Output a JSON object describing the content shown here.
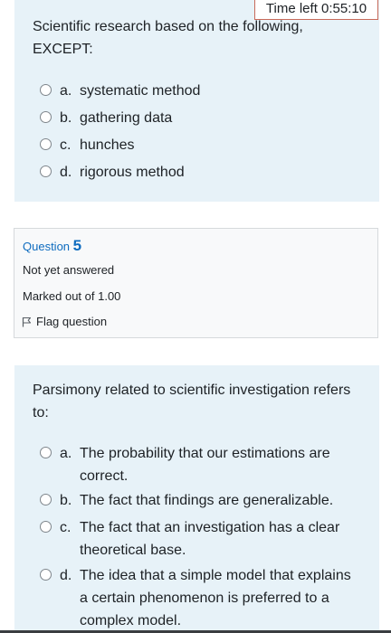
{
  "timer": {
    "label": "Time left 0:55:10"
  },
  "q4": {
    "text": "Scientific research based on the following, EXCEPT:",
    "options": [
      {
        "letter": "a.",
        "text": "systematic method"
      },
      {
        "letter": "b.",
        "text": "gathering data"
      },
      {
        "letter": "c.",
        "text": "hunches"
      },
      {
        "letter": "d.",
        "text": "rigorous method"
      }
    ]
  },
  "q5": {
    "info": {
      "label": "Question",
      "number": "5",
      "state": "Not yet answered",
      "grade": "Marked out of 1.00",
      "flag": "Flag question"
    },
    "text": "Parsimony related to scientific investigation refers to:",
    "options": [
      {
        "letter": "a.",
        "text": "The probability that our estimations are correct."
      },
      {
        "letter": "b.",
        "text": "The fact that findings are generalizable."
      },
      {
        "letter": "c.",
        "text": "The fact that an investigation has a clear theoretical base."
      },
      {
        "letter": "d.",
        "text": "The idea that a simple model that explains a certain phenomenon is preferred to a complex model."
      }
    ]
  },
  "colors": {
    "accent": "#0f6cbf",
    "question_bg": "#e7f2f8",
    "info_bg": "#f8f9fa",
    "timer_border": "#c86a5a"
  }
}
